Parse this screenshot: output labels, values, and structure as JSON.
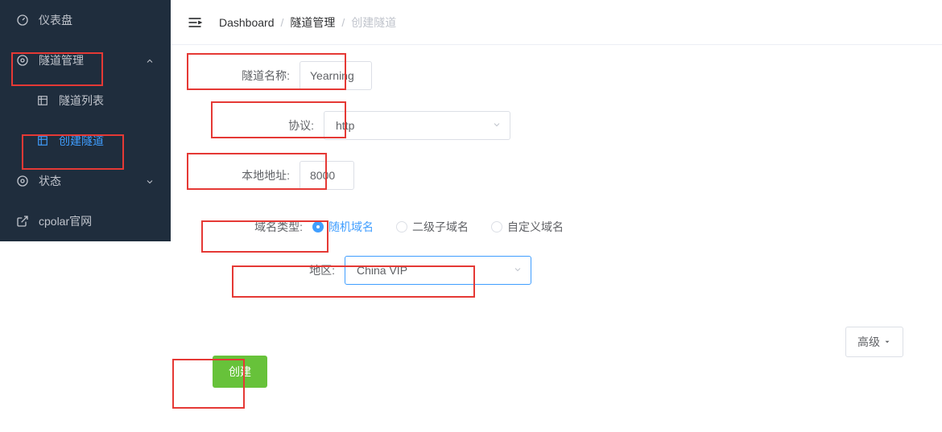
{
  "sidebar": {
    "items": [
      {
        "label": "仪表盘",
        "icon": "dashboard-icon"
      },
      {
        "label": "隧道管理",
        "icon": "target-icon",
        "expanded": true
      },
      {
        "label": "隧道列表",
        "icon": "grid-icon",
        "sub": true
      },
      {
        "label": "创建隧道",
        "icon": "grid-icon",
        "sub": true,
        "active": true
      },
      {
        "label": "状态",
        "icon": "target-icon",
        "expanded": false
      },
      {
        "label": "cpolar官网",
        "icon": "external-link-icon"
      }
    ]
  },
  "breadcrumb": {
    "root": "Dashboard",
    "mid": "隧道管理",
    "current": "创建隧道"
  },
  "form": {
    "name_label": "隧道名称:",
    "name_value": "Yearning",
    "protocol_label": "协议:",
    "protocol_value": "http",
    "local_label": "本地地址:",
    "local_value": "8000",
    "domain_type_label": "域名类型:",
    "domain_options": [
      "随机域名",
      "二级子域名",
      "自定义域名"
    ],
    "region_label": "地区:",
    "region_value": "China VIP",
    "advanced_label": "高级",
    "submit_label": "创建"
  }
}
